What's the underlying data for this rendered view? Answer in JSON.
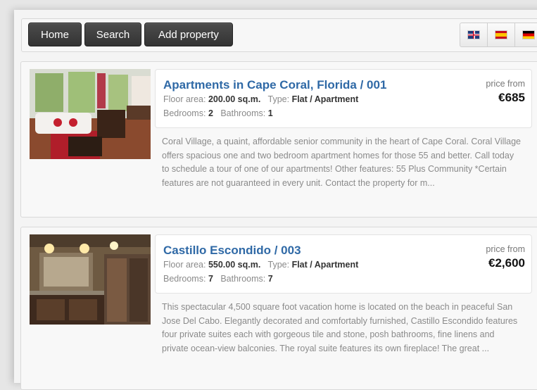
{
  "toolbar": {
    "home": "Home",
    "search": "Search",
    "add_property": "Add property",
    "languages": [
      "English",
      "Spanish",
      "German"
    ]
  },
  "listings": [
    {
      "title": "Apartments in Cape Coral, Florida / 001",
      "floor_area_label": "Floor area:",
      "floor_area": "200.00 sq.m.",
      "type_label": "Type:",
      "type": "Flat / Apartment",
      "bedrooms_label": "Bedrooms:",
      "bedrooms": "2",
      "bathrooms_label": "Bathrooms:",
      "bathrooms": "1",
      "price_label": "price from",
      "price": "€685",
      "description": "Coral Village, a quaint, affordable senior community in the heart of Cape Coral. Coral Village offers spacious one and two bedroom apartment homes for those 55 and better. Call today to schedule a tour of one of our apartments! Other features: 55 Plus Community   *Certain features are not guaranteed in every unit. Contact the property for m..."
    },
    {
      "title": "Castillo Escondido / 003",
      "floor_area_label": "Floor area:",
      "floor_area": "550.00 sq.m.",
      "type_label": "Type:",
      "type": "Flat / Apartment",
      "bedrooms_label": "Bedrooms:",
      "bedrooms": "7",
      "bathrooms_label": "Bathrooms:",
      "bathrooms": "7",
      "price_label": "price from",
      "price": "€2,600",
      "description": "This spectacular 4,500 square foot vacation home is located on the beach in peaceful San Jose Del Cabo. Elegantly decorated and comfortably furnished, Castillo Escondido features four private suites each with gorgeous tile and stone, posh bathrooms, fine linens and private ocean-view balconies. The royal suite features its own fireplace! The great ..."
    }
  ]
}
